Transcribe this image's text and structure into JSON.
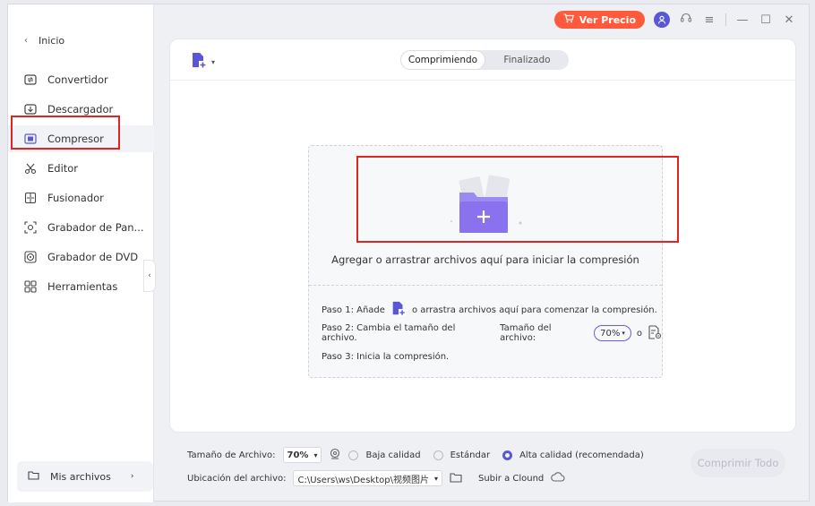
{
  "sidebar": {
    "back_label": "Inicio",
    "items": [
      {
        "label": "Convertidor",
        "icon": "converter-icon"
      },
      {
        "label": "Descargador",
        "icon": "download-icon"
      },
      {
        "label": "Compresor",
        "icon": "compress-icon"
      },
      {
        "label": "Editor",
        "icon": "scissors-icon"
      },
      {
        "label": "Fusionador",
        "icon": "merge-icon"
      },
      {
        "label": "Grabador de Pan...",
        "icon": "screen-record-icon"
      },
      {
        "label": "Grabador de DVD",
        "icon": "disc-icon"
      },
      {
        "label": "Herramientas",
        "icon": "grid-icon"
      }
    ],
    "active_index": 2,
    "my_files_label": "Mis archivos"
  },
  "topbar": {
    "price_label": "Ver Precio"
  },
  "tabs": [
    {
      "label": "Comprimiendo",
      "active": true
    },
    {
      "label": "Finalizado",
      "active": false
    }
  ],
  "drop_zone": {
    "text": "Agregar o arrastrar archivos aquí para iniciar la compresión",
    "step1_a": "Paso 1: Añade",
    "step1_b": "o arrastra archivos aquí para comenzar la compresión.",
    "step2_a": "Paso 2: Cambia el tamaño del archivo.",
    "step2_b": "Tamaño del archivo:",
    "step2_value": "70%",
    "step2_or": "o",
    "step3": "Paso 3: Inicia la compresión."
  },
  "bottom": {
    "file_size_label": "Tamaño de Archivo:",
    "file_size_value": "70%",
    "quality_low": "Baja calidad",
    "quality_std": "Estándar",
    "quality_high": "Alta calidad (recomendada)",
    "location_label": "Ubicación del archivo:",
    "location_value": "C:\\Users\\ws\\Desktop\\视频图片",
    "upload_label": "Subir a Clound",
    "compress_all_label": "Comprimir Todo"
  },
  "colors": {
    "accent": "#5a57d6",
    "price": "#ff5a3c",
    "highlight_box": "#e02424"
  }
}
